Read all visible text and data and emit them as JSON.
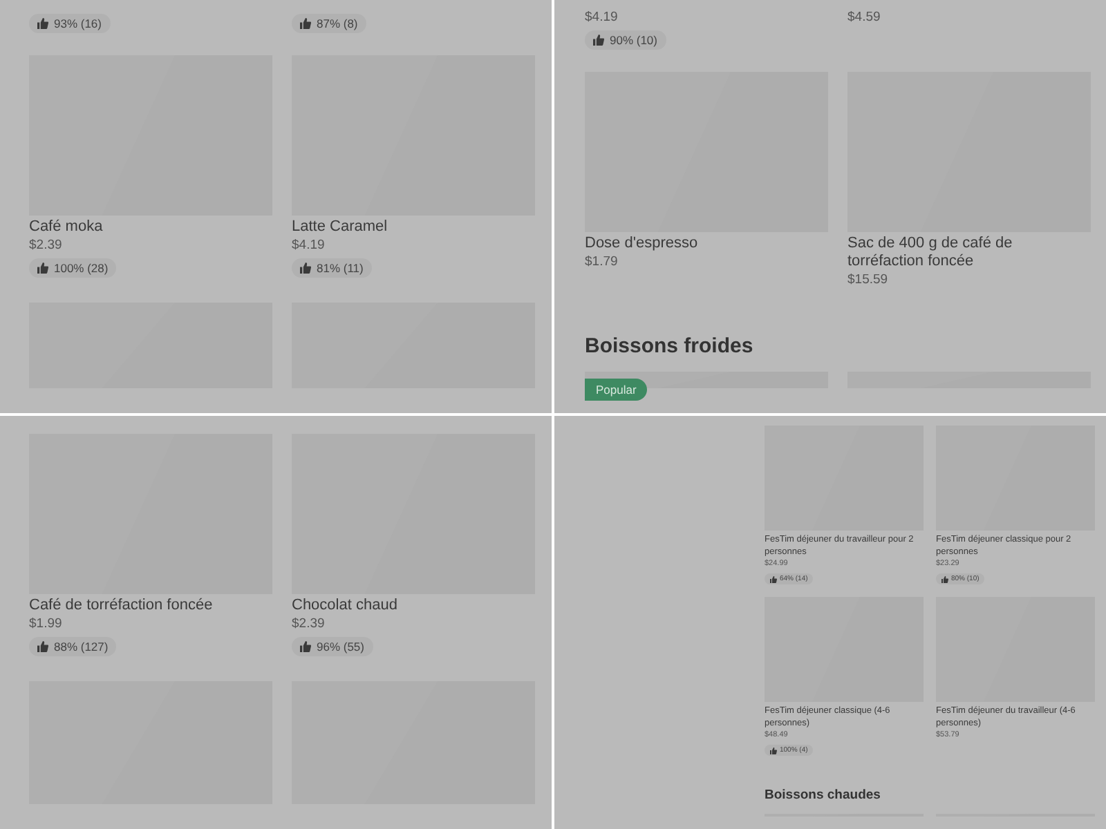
{
  "panels": [
    {
      "compact": false,
      "rows": [
        {
          "kind": "top",
          "items": [
            {
              "rating": "93% (16)"
            },
            {
              "rating": "87% (8)"
            }
          ]
        },
        {
          "kind": "cards",
          "items": [
            {
              "name": "Café moka",
              "price": "$2.39",
              "rating": "100% (28)"
            },
            {
              "name": "Latte Caramel",
              "price": "$4.19",
              "rating": "81% (11)"
            }
          ]
        },
        {
          "kind": "images",
          "items": [
            {
              "kind": "picture"
            },
            {
              "kind": "picture"
            }
          ]
        }
      ]
    },
    {
      "compact": false,
      "rows": [
        {
          "kind": "top",
          "items": [
            {
              "price": "$4.19",
              "rating": "90% (10)"
            },
            {
              "price": "$4.59"
            }
          ]
        },
        {
          "kind": "cards",
          "items": [
            {
              "name": "Dose d'espresso",
              "price": "$1.79"
            },
            {
              "name": "Sac de 400 g de café de torréfaction foncée",
              "price": "$15.59"
            }
          ]
        },
        {
          "kind": "heading",
          "text": "Boissons froides"
        },
        {
          "kind": "images",
          "items": [
            {
              "kind": "picture",
              "badge": "Popular"
            },
            {
              "kind": "picture"
            }
          ]
        }
      ]
    },
    {
      "compact": false,
      "rows": [
        {
          "kind": "cards",
          "items": [
            {
              "name": "Café de torréfaction foncée",
              "price": "$1.99",
              "rating": "88% (127)"
            },
            {
              "name": "Chocolat chaud",
              "price": "$2.39",
              "rating": "96% (55)"
            }
          ]
        },
        {
          "kind": "images",
          "items": [
            {
              "kind": "picture"
            },
            {
              "kind": "picture"
            }
          ]
        }
      ]
    },
    {
      "compact": true,
      "rows": [
        {
          "kind": "cards",
          "items": [
            {
              "name": "FesTim déjeuner du travailleur pour 2 personnes",
              "price": "$24.99",
              "rating": "64% (14)"
            },
            {
              "name": "FesTim déjeuner classique pour 2 personnes",
              "price": "$23.29",
              "rating": "80% (10)"
            }
          ]
        },
        {
          "kind": "cards",
          "items": [
            {
              "name": "FesTim déjeuner classique (4-6 personnes)",
              "price": "$48.49",
              "rating": "100% (4)"
            },
            {
              "name": "FesTim déjeuner du travailleur (4-6 personnes)",
              "price": "$53.79"
            }
          ]
        },
        {
          "kind": "heading",
          "text": "Boissons chaudes"
        },
        {
          "kind": "images",
          "items": [
            {
              "kind": "picture"
            },
            {
              "kind": "picture"
            }
          ]
        }
      ]
    }
  ]
}
